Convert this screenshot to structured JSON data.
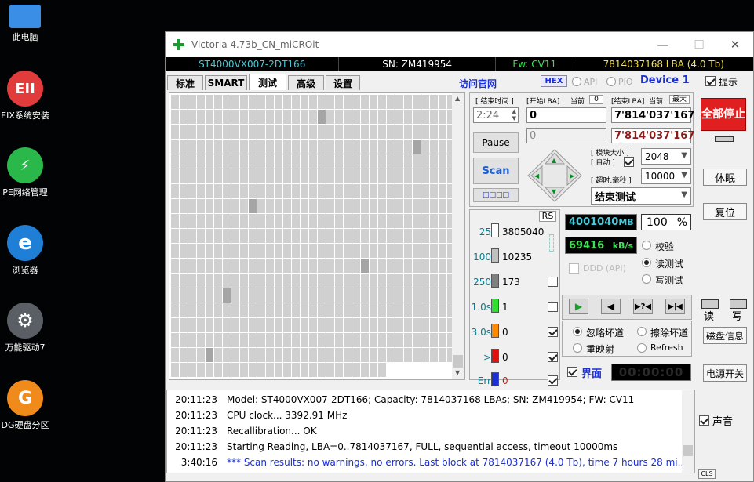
{
  "desktop": {
    "icons": [
      {
        "label": "此电脑",
        "glyph": "",
        "color": "#3a8ee6"
      },
      {
        "label": "EIX系统安装",
        "glyph": "EII",
        "color": "#e23b3b"
      },
      {
        "label": "PE网络管理",
        "glyph": "⚡",
        "color": "#2bb84a"
      },
      {
        "label": "浏览器",
        "glyph": "e",
        "color": "#1f7fd6"
      },
      {
        "label": "万能驱动7",
        "glyph": "⚙",
        "color": "#5a5f66"
      },
      {
        "label": "DG硬盘分区",
        "glyph": "G",
        "color": "#f08a1a"
      }
    ]
  },
  "window": {
    "title": "Victoria 4.73b_CN_miCROit",
    "info": {
      "model": "ST4000VX007-2DT166",
      "serial": "SN: ZM419954",
      "firmware": "Fw: CV11",
      "capacity": "7814037168 LBA (4.0 Tb)"
    },
    "tabs": [
      "标准",
      "SMART",
      "测试",
      "高级",
      "设置"
    ],
    "active_tab": "测试",
    "visit_link": "访问官网",
    "hex_label": "HEX",
    "api_label": "API",
    "pio_label": "PIO",
    "device_label": "Device 1",
    "hint_label": "提示"
  },
  "test": {
    "end_time_label": "[ 结束时间 ]",
    "end_time": "2:24",
    "start_lba_label": "[开始LBA]",
    "start_lba_cur": "当前",
    "start_lba_zero": "0",
    "end_lba_label": "[结束LBA]",
    "end_lba_cur": "当前",
    "end_lba_max": "最大",
    "start_lba": "0",
    "end_lba": "7'814'037'167",
    "current_lba": "0",
    "current_end_lba": "7'814'037'167",
    "pause_label": "Pause",
    "scan_label": "Scan",
    "small_btn": "□□□□",
    "block_size_label": "[ 模块大小 ]",
    "auto_label": "[ 自动 ]",
    "block_size": "2048",
    "timeout_label": "[ 超时,毫秒 ]",
    "timeout": "10000",
    "end_action": "结束测试",
    "stop_all": "全部停止"
  },
  "stats": {
    "rs_label": "RS",
    "rows": [
      {
        "label": "25",
        "count": "3805040",
        "color": "#ffffff"
      },
      {
        "label": "100",
        "count": "10235",
        "color": "#c0c0c0"
      },
      {
        "label": "250",
        "count": "173",
        "color": "#808080"
      },
      {
        "label": "1.0s",
        "count": "1",
        "color": "#2ee02e"
      },
      {
        "label": "3.0s",
        "count": "0",
        "color": "#ff8a00"
      },
      {
        "label": ">",
        "count": "0",
        "color": "#e01010"
      },
      {
        "label": "Err",
        "count": "0",
        "color": "#1a2fd6"
      }
    ],
    "mb_value": "4001040",
    "mb_unit": "MB",
    "percent": "100",
    "percent_unit": "%",
    "speed": "69416",
    "speed_unit": "kB/s",
    "ddd_label": "DDD (API)"
  },
  "modes": {
    "verify": "校验",
    "read": "读测试",
    "write": "写测试"
  },
  "actions": {
    "ignore": "忽略坏道",
    "erase": "擦除坏道",
    "remap": "重映射",
    "refresh": "Refresh",
    "ui_label": "界面",
    "timer": "00:00:00"
  },
  "right": {
    "sleep": "休眠",
    "reset": "复位",
    "read_label": "读",
    "write_label": "写",
    "disk_info": "磁盘信息",
    "power": "电源开关",
    "sound": "声音",
    "cls": "CLS"
  },
  "log": [
    {
      "time": "20:11:23",
      "msg": "Model: ST4000VX007-2DT166; Capacity: 7814037168 LBAs; SN: ZM419954; FW: CV11"
    },
    {
      "time": "20:11:23",
      "msg": "CPU clock... 3392.91 MHz"
    },
    {
      "time": "20:11:23",
      "msg": "Recallibration... OK"
    },
    {
      "time": "20:11:23",
      "msg": "Starting Reading, LBA=0..7814037167, FULL, sequential access, timeout 10000ms"
    },
    {
      "time": "3:40:16",
      "msg": "*** Scan results: no warnings, no errors. Last block at 7814037167 (4.0 Tb), time 7 hours 28 mi..."
    }
  ]
}
